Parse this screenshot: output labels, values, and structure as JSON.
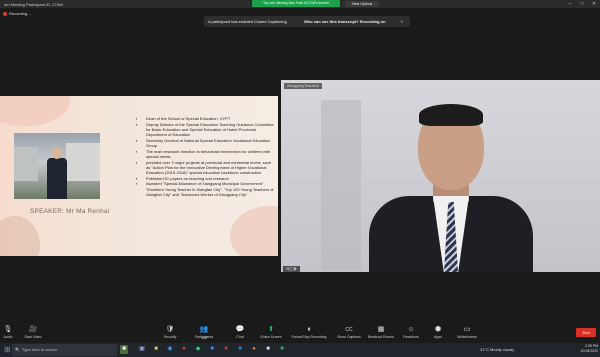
{
  "window": {
    "title": "om Meeting Participant ID: 27640",
    "share_banner": "You are viewing Bao Fafa ICCCM's screen",
    "view_options": "View Options",
    "controls": [
      "–",
      "□",
      "✕"
    ]
  },
  "recording": {
    "label": "Recording..."
  },
  "caption_notice": {
    "text": "A participant has enabled Closed Captioning",
    "link": "Who can see this transcript? Recording on",
    "close": "✕"
  },
  "slide": {
    "speaker_label": "SPEAKER: Mr Ma Renhai",
    "bullets": [
      "Dean of the School of Special Education, XYPT",
      "Deputy Director of the Special Education Teaching Guidance Committee for Basic Education and Special Education of Hubei Provincial Department of Education",
      "Secretary General of National Special Education Vocational Education Group",
      "The main research direction is behavioral intervention for children with special needs",
      "presided over 3 major projects at provincial and ministerial levels, such as \"Action Plan for the Innovative Development of Higher Vocational Education (2015-2018)\" special education backbone construction",
      "Published 51 papers on teaching and research",
      "Awarded \"Special Allowance of Xiangyang Municipal Government\", \"Excellent Young Teacher in Xiangfan City\", \"Top 100 Young Teachers of Xiangfan City\" and \"Advanced Worker of Xiangyang City\""
    ]
  },
  "video": {
    "name_top": "Xiangyang Teachers'",
    "name_bottom": "马仁海"
  },
  "toolbar": {
    "items": [
      {
        "label": "Audio",
        "icon": "🎙"
      },
      {
        "label": "Start Video",
        "icon": "🎥"
      },
      {
        "label": "Security",
        "icon": "🛡"
      },
      {
        "label": "Participants",
        "icon": "👥",
        "count": "123"
      },
      {
        "label": "Chat",
        "icon": "💬"
      },
      {
        "label": "Share Screen",
        "icon": "⬆"
      },
      {
        "label": "Pause/Stop Recording",
        "icon": "⏸"
      },
      {
        "label": "Show Captions",
        "icon": "CC"
      },
      {
        "label": "Breakout Rooms",
        "icon": "▦"
      },
      {
        "label": "Reactions",
        "icon": "☺"
      },
      {
        "label": "Apps",
        "icon": "⬢"
      },
      {
        "label": "Whiteboards",
        "icon": "▭"
      }
    ],
    "end_label": "End"
  },
  "taskbar": {
    "search_placeholder": "Type here to search",
    "weather": "31°C  Mostly cloudy",
    "time": "2:05 PM",
    "date": "10/16/2022"
  }
}
